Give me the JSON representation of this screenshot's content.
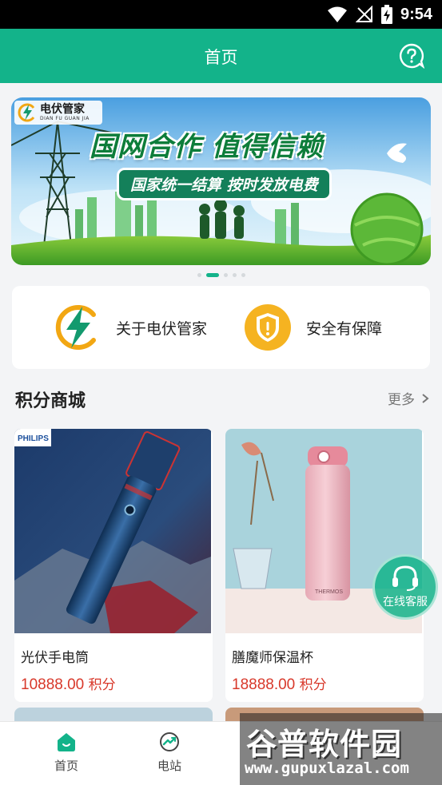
{
  "status_bar": {
    "time": "9:54"
  },
  "header": {
    "title": "首页"
  },
  "banner": {
    "logo_name": "电伏管家",
    "logo_en": "DIAN FU GUAN JIA",
    "headline": "国网合作 值得信赖",
    "subline": "国家统一结算 按时发放电费"
  },
  "about": {
    "items": [
      {
        "label": "关于电伏管家",
        "icon": "lightning-logo-icon"
      },
      {
        "label": "安全有保障",
        "icon": "shield-icon"
      }
    ]
  },
  "mall": {
    "title": "积分商城",
    "more": "更多"
  },
  "products": [
    {
      "name": "光伏手电筒",
      "points": "10888.00",
      "unit": "积分",
      "brand": "PHILIPS"
    },
    {
      "name": "膳魔师保温杯",
      "points": "18888.00",
      "unit": "积分"
    }
  ],
  "float_service": {
    "label": "在线客服",
    "icon": "headset-icon"
  },
  "bottom_nav": [
    {
      "label": "首页",
      "icon": "home-icon",
      "active": true
    },
    {
      "label": "电站",
      "icon": "station-icon",
      "active": false
    }
  ],
  "watermark": {
    "cn": "谷普软件园",
    "en": "www.gupuxlazal.com"
  },
  "colors": {
    "primary": "#13b38a",
    "price": "#d8382a",
    "shield": "#f5b321"
  }
}
